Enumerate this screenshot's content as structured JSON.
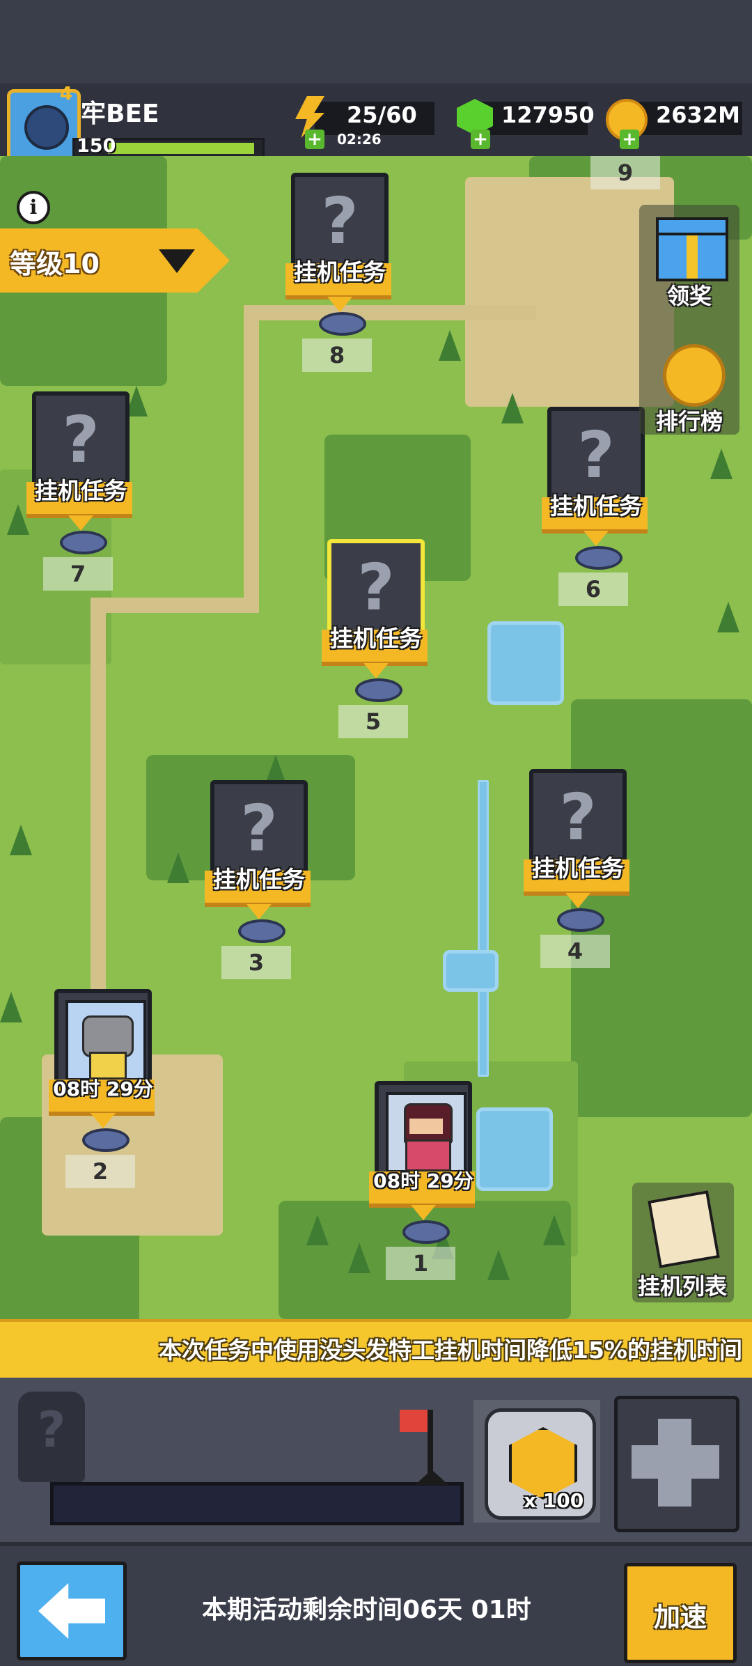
{
  "player": {
    "name": "牢BEE",
    "level_badge": "4",
    "xp_value": "150"
  },
  "resources": {
    "energy": "25/60",
    "energy_timer": "02:26",
    "gems": "127950",
    "gold": "2632M"
  },
  "map": {
    "level_selector": "等级10",
    "top_partial_number": "9",
    "nodes": [
      {
        "number": "8",
        "label": "挂机任务"
      },
      {
        "number": "7",
        "label": "挂机任务"
      },
      {
        "number": "6",
        "label": "挂机任务"
      },
      {
        "number": "5",
        "label": "挂机任务"
      },
      {
        "number": "4",
        "label": "挂机任务"
      },
      {
        "number": "3",
        "label": "挂机任务"
      },
      {
        "number": "2",
        "label": "08时 29分"
      },
      {
        "number": "1",
        "label": "08时 29分"
      }
    ],
    "rewards_label": "领奖",
    "leaderboard_label": "排行榜",
    "idle_list_label": "挂机列表"
  },
  "banner": {
    "text": "本次任务中使用没头发特工挂机时间降低15%的挂机时间"
  },
  "panel": {
    "boost_count": "x 100"
  },
  "footer": {
    "remaining": "本期活动剩余时间06天 01时",
    "speedup": "加速"
  },
  "colors": {
    "accent_yellow": "#f5b825",
    "map_green": "#8cbf4e",
    "back_blue": "#4fb0f0"
  }
}
